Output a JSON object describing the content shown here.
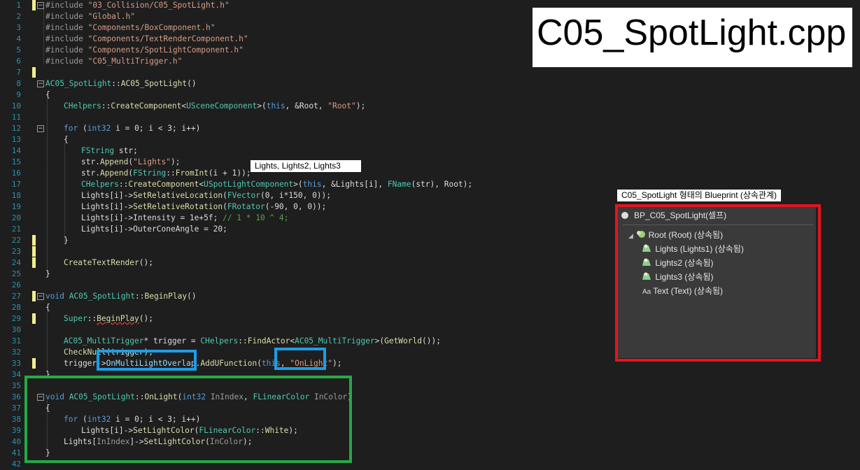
{
  "title_label": "C05_SpotLight.cpp",
  "annotation_lights": "Lights, Lights2, Lights3",
  "annotation_blueprint": "C05_SpotLight 형태의 Blueprint (상속관계)",
  "panel": {
    "root": "BP_C05_SpotLight(셀프)",
    "items": [
      "Root (Root) (상속됨)",
      "Lights (Lights1) (상속됨)",
      "Lights2 (상속됨)",
      "Lights3 (상속됨)",
      "Text (Text) (상속됨)"
    ]
  },
  "line_numbers": [
    "1",
    "2",
    "3",
    "4",
    "5",
    "6",
    "7",
    "8",
    "9",
    "10",
    "11",
    "12",
    "13",
    "14",
    "15",
    "16",
    "17",
    "18",
    "19",
    "20",
    "21",
    "22",
    "23",
    "24",
    "25",
    "26",
    "27",
    "28",
    "29",
    "30",
    "31",
    "32",
    "33",
    "34",
    "35",
    "36",
    "37",
    "38",
    "39",
    "40",
    "41",
    "42"
  ],
  "code": {
    "l1a": "#include ",
    "l1b": "\"03_Collision/C05_SpotLight.h\"",
    "l2a": "#include ",
    "l2b": "\"Global.h\"",
    "l3a": "#include ",
    "l3b": "\"Components/BoxComponent.h\"",
    "l4a": "#include ",
    "l4b": "\"Components/TextRenderComponent.h\"",
    "l5a": "#include ",
    "l5b": "\"Components/SpotLightComponent.h\"",
    "l6a": "#include ",
    "l6b": "\"C05_MultiTrigger.h\"",
    "l8a": "AC05_SpotLight",
    "l8b": "::",
    "l8c": "AC05_SpotLight",
    "l8d": "()",
    "l9": "{",
    "l10a": "CHelpers",
    "l10b": "::",
    "l10c": "CreateComponent",
    "l10d": "<",
    "l10e": "USceneComponent",
    "l10f": ">(",
    "l10g": "this",
    "l10h": ", &Root, ",
    "l10i": "\"Root\"",
    "l10j": ");",
    "l12a": "for",
    "l12b": " (",
    "l12c": "int32",
    "l12d": " i = 0; i < 3; i++)",
    "l13": "{",
    "l14a": "FString",
    "l14b": " str;",
    "l15a": "str.",
    "l15b": "Append",
    "l15c": "(",
    "l15d": "\"Lights\"",
    "l15e": ");",
    "l16a": "str.",
    "l16b": "Append",
    "l16c": "(",
    "l16d": "FString",
    "l16e": "::",
    "l16f": "FromInt",
    "l16g": "(i + 1));",
    "l17a": "CHelpers",
    "l17b": "::",
    "l17c": "CreateComponent",
    "l17d": "<",
    "l17e": "USpotLightComponent",
    "l17f": ">(",
    "l17g": "this",
    "l17h": ", &Lights[i], ",
    "l17i": "FName",
    "l17j": "(str), Root);",
    "l18a": "Lights[i]->",
    "l18b": "SetRelativeLocation",
    "l18c": "(",
    "l18d": "FVector",
    "l18e": "(0, i*150, 0));",
    "l19a": "Lights[i]->",
    "l19b": "SetRelativeRotation",
    "l19c": "(",
    "l19d": "FRotator",
    "l19e": "(-90, 0, 0));",
    "l20a": "Lights[i]->Intensity = 1e+5f; ",
    "l20b": "// 1 * 10 ^ 4;",
    "l21a": "Lights[i]->OuterConeAngle = 20;",
    "l22": "}",
    "l24a": "CreateTextRender",
    "l24b": "();",
    "l25": "}",
    "l27a": "void",
    "l27b": " AC05_SpotLight",
    "l27c": "::",
    "l27d": "BeginPlay",
    "l27e": "()",
    "l28": "{",
    "l29a": "Super",
    "l29b": "::",
    "l29c": "BeginPlay",
    "l29d": "();",
    "l31a": "AC05_MultiTrigger",
    "l31b": "* trigger = ",
    "l31c": "CHelpers",
    "l31d": "::",
    "l31e": "FindActor",
    "l31f": "<",
    "l31g": "AC05_MultiTrigger",
    "l31h": ">(",
    "l31i": "GetWorld",
    "l31j": "());",
    "l32a": "CheckNull",
    "l32b": "(trigger);",
    "l33a": "trigger->",
    "l33b": "OnMultiLightOverlap",
    "l33c": ".",
    "l33d": "AddUFunction",
    "l33e": "(",
    "l33f": "this",
    "l33g": ", ",
    "l33h": "\"OnLight\"",
    "l33i": ");",
    "l34": "}",
    "l36a": "void",
    "l36b": " AC05_SpotLight",
    "l36c": "::",
    "l36d": "OnLight",
    "l36e": "(",
    "l36f": "int32",
    "l36g": " InIndex",
    "l36h": ", ",
    "l36i": "FLinearColor",
    "l36j": " InColor",
    "l36k": ")",
    "l37": "{",
    "l38a": "for",
    "l38b": " (",
    "l38c": "int32",
    "l38d": " i = 0; i < 3; i++)",
    "l39a": "Lights[i]->",
    "l39b": "SetLightColor",
    "l39c": "(",
    "l39d": "FLinearColor",
    "l39e": "::",
    "l39f": "White",
    "l39g": ");",
    "l40a": "Lights[",
    "l40b": "InIndex",
    "l40c": "]->",
    "l40d": "SetLightColor",
    "l40e": "(",
    "l40f": "InColor",
    "l40g": ");",
    "l41": "}"
  }
}
